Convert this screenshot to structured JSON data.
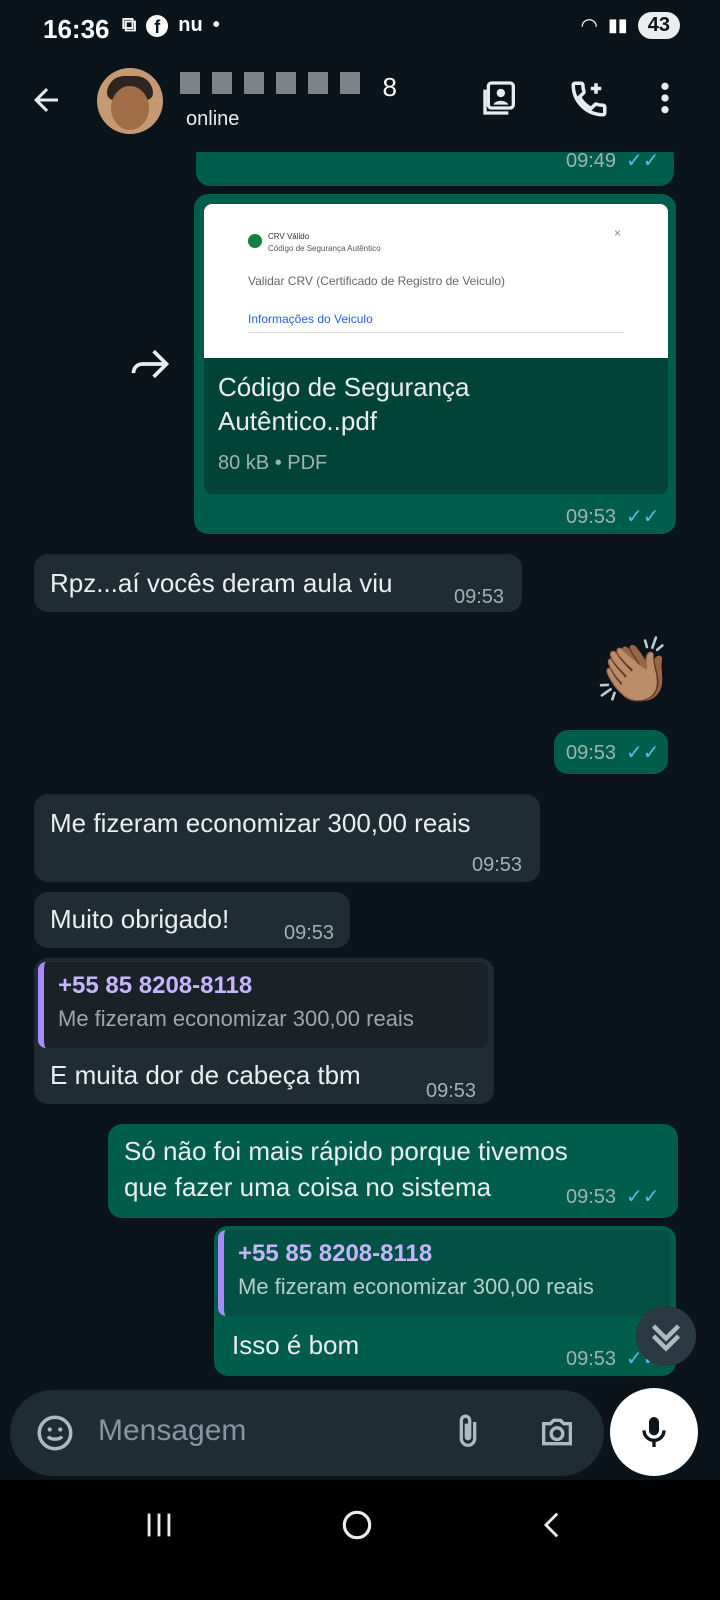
{
  "status_bar": {
    "time": "16:36",
    "left_icons": [
      "screenshot-icon",
      "facebook-icon",
      "nu-icon",
      "dot-icon"
    ],
    "nu_label": "nu",
    "battery": "43"
  },
  "header": {
    "contact_name_tail": "8",
    "status": "online"
  },
  "messages": {
    "m1": {
      "time": "09:49"
    },
    "pdf": {
      "preview_title": "CRV Válido",
      "preview_sub": "Código de Segurança Autêntico",
      "preview_heading": "Validar CRV (Certificado de Registro de Veiculo)",
      "preview_link": "Informações do Veiculo",
      "file_name": "Código de Segurança\nAutêntico..pdf",
      "file_name_line1": "Código de Segurança",
      "file_name_line2": "Autêntico..pdf",
      "file_meta": "80 kB • PDF",
      "time": "09:53"
    },
    "m2": {
      "text": "Rpz...aí vocês deram aula viu",
      "time": "09:53"
    },
    "m3": {
      "emoji": "👏🏽",
      "time": "09:53"
    },
    "m4": {
      "text": "Me fizeram economizar 300,00 reais",
      "time": "09:53"
    },
    "m5": {
      "text": "Muito obrigado!",
      "time": "09:53"
    },
    "m6": {
      "quote_author": "+55 85 8208-8118",
      "quote_text": "Me fizeram economizar 300,00 reais",
      "text": "E muita dor de cabeça tbm",
      "time": "09:53"
    },
    "m7": {
      "line1": "Só não foi mais rápido porque tivemos",
      "line2": "que fazer uma coisa no sistema",
      "time": "09:53"
    },
    "m8": {
      "quote_author": "+55 85 8208-8118",
      "quote_text": "Me fizeram economizar 300,00 reais",
      "text": "Isso é bom",
      "time": "09:53"
    }
  },
  "composer": {
    "placeholder": "Mensagem"
  },
  "colors": {
    "background": "#0b141a",
    "outgoing": "#005c4b",
    "incoming": "#202c33",
    "read_ticks": "#53bdeb"
  }
}
